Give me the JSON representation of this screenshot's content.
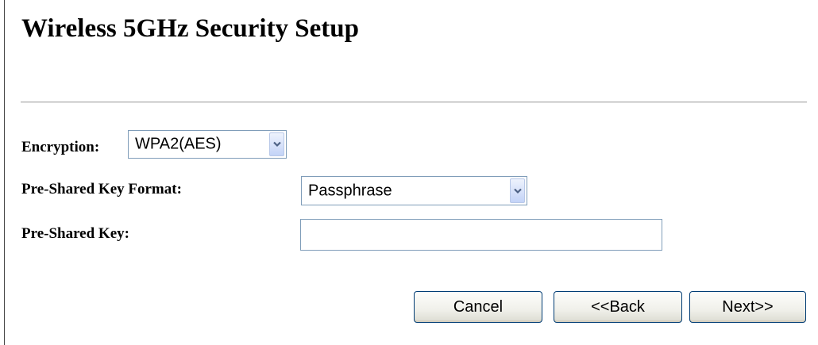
{
  "page": {
    "title": "Wireless 5GHz Security Setup"
  },
  "form": {
    "encryption": {
      "label": "Encryption:",
      "value": "WPA2(AES)"
    },
    "psk_format": {
      "label": "Pre-Shared Key Format:",
      "value": "Passphrase"
    },
    "psk": {
      "label": "Pre-Shared Key:",
      "value": ""
    }
  },
  "buttons": {
    "cancel": "Cancel",
    "back": "<<Back",
    "next": "Next>>"
  },
  "icons": {
    "dropdown": "chevron-down-icon"
  },
  "colors": {
    "input_border": "#7f9db9",
    "button_border": "#003c74",
    "divider": "#b0b0b0"
  }
}
